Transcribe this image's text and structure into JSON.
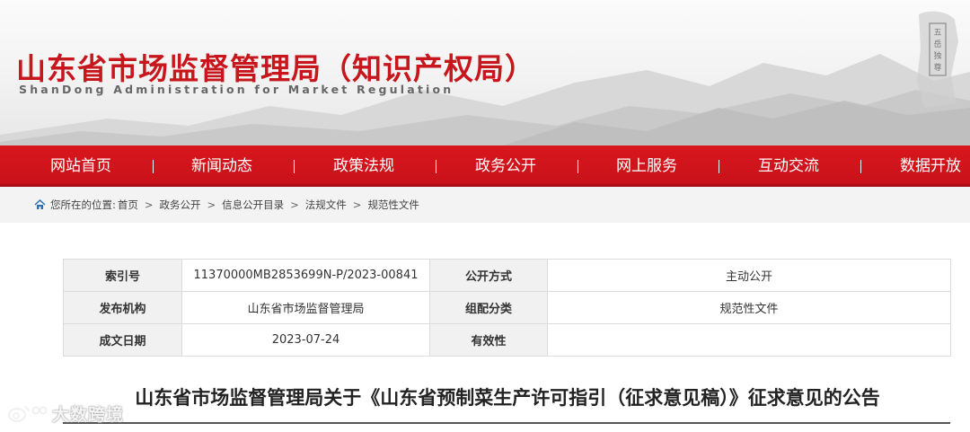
{
  "header": {
    "title": "山东省市场监督管理局（知识产权局）",
    "subtitle": "ShanDong Administration for Market Regulation",
    "brand_color": "#c8161d"
  },
  "nav": {
    "items": [
      {
        "label": "网站首页"
      },
      {
        "label": "新闻动态"
      },
      {
        "label": "政策法规"
      },
      {
        "label": "政务公开"
      },
      {
        "label": "网上服务"
      },
      {
        "label": "互动交流"
      },
      {
        "label": "数据开放"
      }
    ],
    "separator": "|",
    "bg_color": "#d9161d"
  },
  "breadcrumb": {
    "icon": "home-icon",
    "prefix": "您所在的位置:",
    "items": [
      "首页",
      "政务公开",
      "信息公开目录",
      "法规文件",
      "规范性文件"
    ],
    "separator": ">"
  },
  "info": {
    "rows": [
      {
        "label1": "索引号",
        "value1": "11370000MB2853699N-P/2023-00841",
        "label2": "公开方式",
        "value2": "主动公开"
      },
      {
        "label1": "发布机构",
        "value1": "山东省市场监督管理局",
        "label2": "组配分类",
        "value2": "规范性文件"
      },
      {
        "label1": "成文日期",
        "value1": "2023-07-24",
        "label2": "有效性",
        "value2": ""
      }
    ]
  },
  "article": {
    "title": "山东省市场监督管理局关于《山东省预制菜生产许可指引（征求意见稿）》征求意见的公告"
  },
  "watermark": {
    "icon": "weibo-icon",
    "text": "大数跨境"
  }
}
